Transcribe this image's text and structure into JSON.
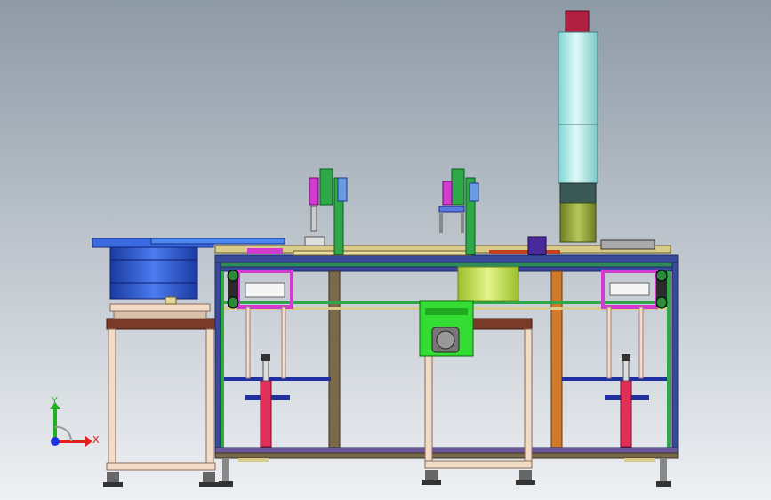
{
  "viewport": {
    "name": "cad-3d-viewport"
  },
  "colors": {
    "bg_top": "#8e9aa6",
    "bg_bottom": "#eef1f4",
    "frame_blue": "#3a4a9a",
    "frame_edge": "#1f2a66",
    "frame_brown": "#7a6a4a",
    "frame_orange": "#d07a2a",
    "feeder_blue": "#2f5fd6",
    "feeder_dark": "#1a3aa0",
    "table_wood": "#7a3a2a",
    "table_leg": "#f3dcc7",
    "welder_cyan": "#aee8e6",
    "welder_cap": "#b02040",
    "horn_olive": "#8a9a3a",
    "magenta": "#d23ad0",
    "green_box": "#33dd33",
    "lime": "#c8e84a",
    "red_cyl": "#e0305a",
    "rail_green": "#2fa84a",
    "rail_tan": "#d9cc8a"
  },
  "triad": {
    "x_label": "X",
    "y_label": "Y",
    "x_color": "#e02020",
    "y_color": "#20b020",
    "z_color": "#2030e0"
  }
}
